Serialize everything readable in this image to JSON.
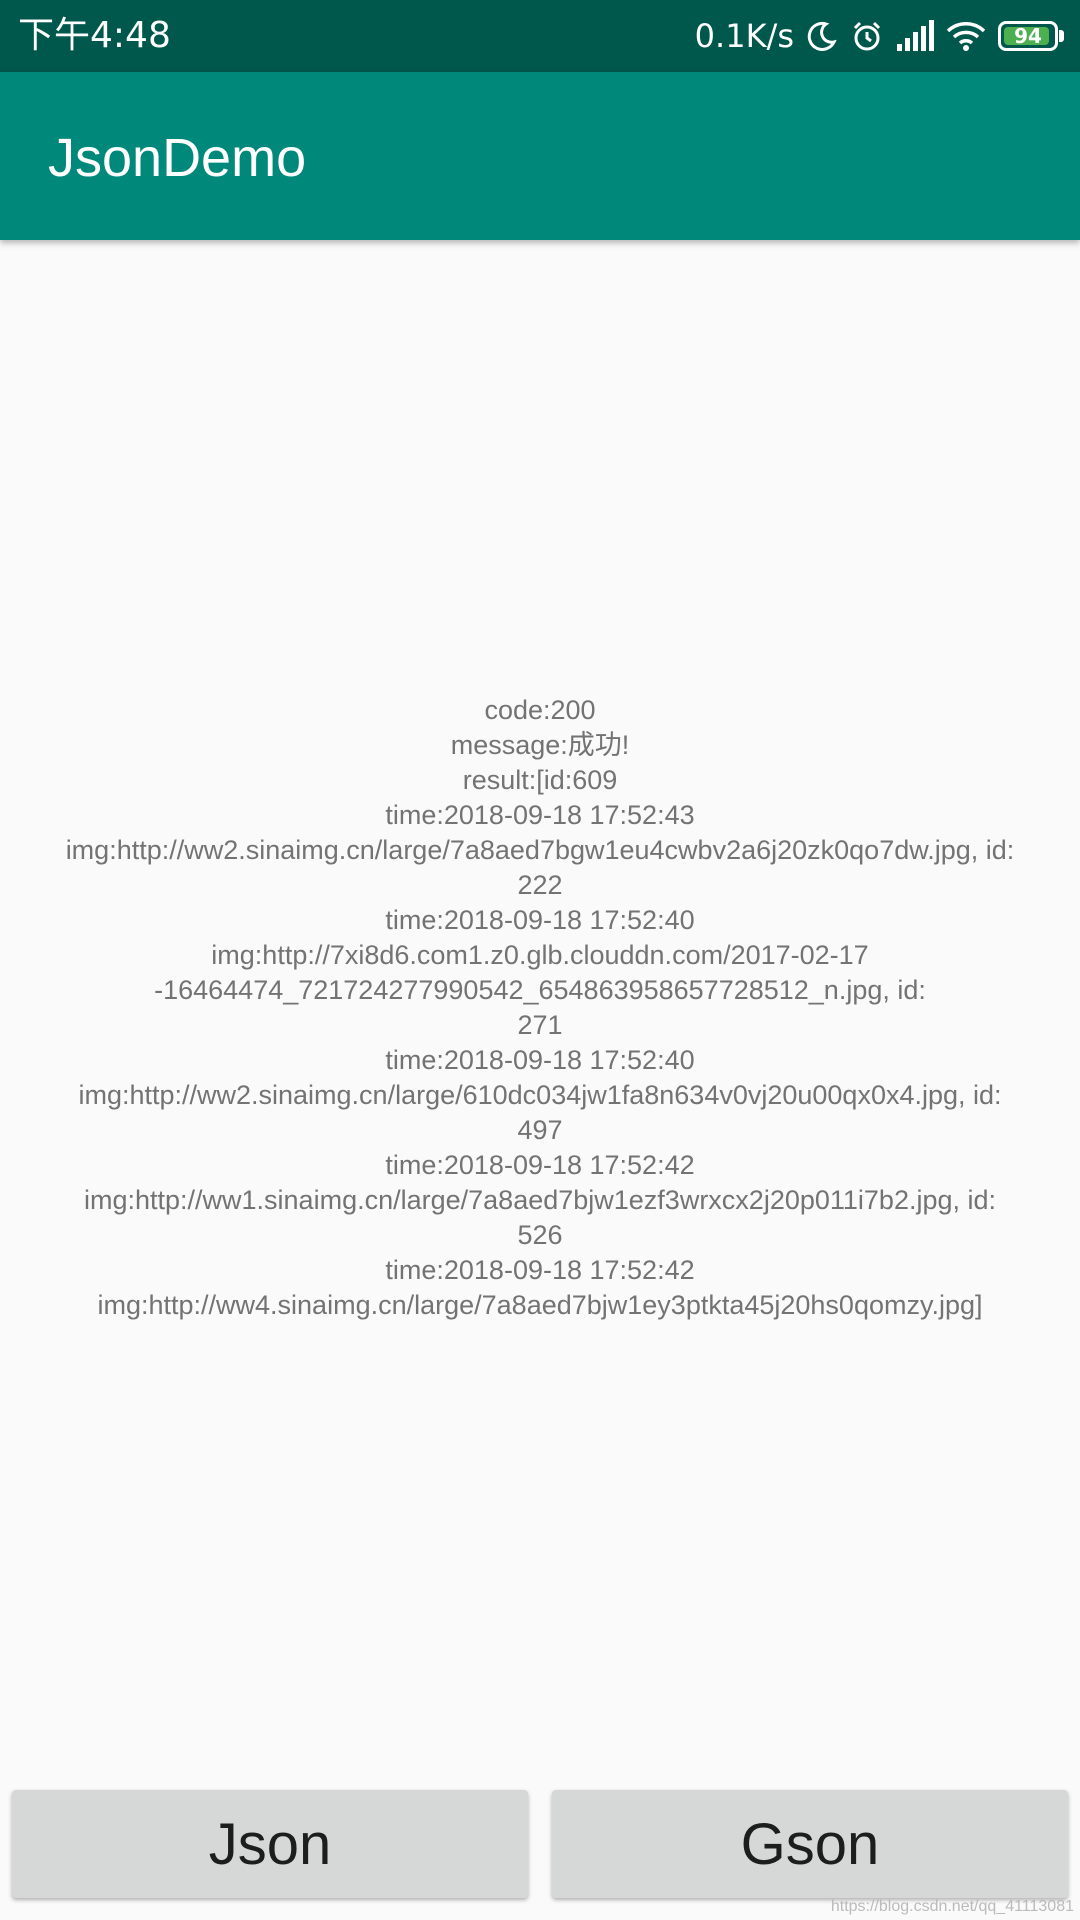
{
  "status_bar": {
    "time": "下午4:48",
    "net_speed": "0.1K/s",
    "icons": [
      "moon-icon",
      "alarm-icon",
      "signal-icon",
      "wifi-icon",
      "battery-icon"
    ],
    "battery_level": "94",
    "battery_fraction": 0.94,
    "background": "#00574b"
  },
  "app_bar": {
    "title": "JsonDemo",
    "background": "#00897b"
  },
  "content": {
    "lines": [
      "code:200",
      "message:成功!",
      "result:[id:609",
      "time:2018-09-18 17:52:43",
      "img:http://ww2.sinaimg.cn/large/7a8aed7bgw1eu4cwbv2a6j20zk0qo7dw.jpg, id:",
      "222",
      "time:2018-09-18 17:52:40",
      "img:http://7xi8d6.com1.z0.glb.clouddn.com/2017-02-17",
      "-16464474_721724277990542_654863958657728512_n.jpg, id:",
      "271",
      "time:2018-09-18 17:52:40",
      "img:http://ww2.sinaimg.cn/large/610dc034jw1fa8n634v0vj20u00qx0x4.jpg, id:",
      "497",
      "time:2018-09-18 17:52:42",
      "img:http://ww1.sinaimg.cn/large/7a8aed7bjw1ezf3wrxcx2j20p011i7b2.jpg, id:",
      "526",
      "time:2018-09-18 17:52:42",
      "img:http://ww4.sinaimg.cn/large/7a8aed7bjw1ey3ptkta45j20hs0qomzy.jpg]"
    ]
  },
  "buttons": {
    "json_label": "Json",
    "gson_label": "Gson"
  },
  "watermark": "https://blog.csdn.net/qq_41113081"
}
